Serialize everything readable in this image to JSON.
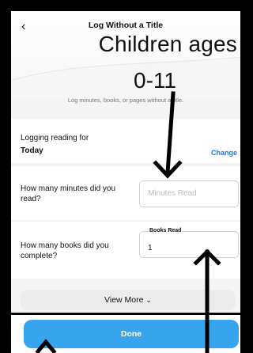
{
  "nav": {
    "title": "Log Without a Title",
    "back_icon": "chevron-left-icon"
  },
  "overlay": {
    "title": "Children ages",
    "subtitle": "0-11"
  },
  "hint": "Log minutes, books, or pages without a title.",
  "logging": {
    "label": "Logging reading for",
    "value": "Today",
    "change_label": "Change"
  },
  "minutes": {
    "question": "How many minutes did you read?",
    "placeholder": "Minutes Read"
  },
  "books": {
    "question": "How many books did you complete?",
    "legend": "Books Read",
    "value": "1"
  },
  "view_more": {
    "label": "View More",
    "icon": "chevron-down-icon"
  },
  "done": {
    "label": "Done"
  },
  "colors": {
    "accent": "#36a5ee",
    "link": "#1c7bd6"
  }
}
